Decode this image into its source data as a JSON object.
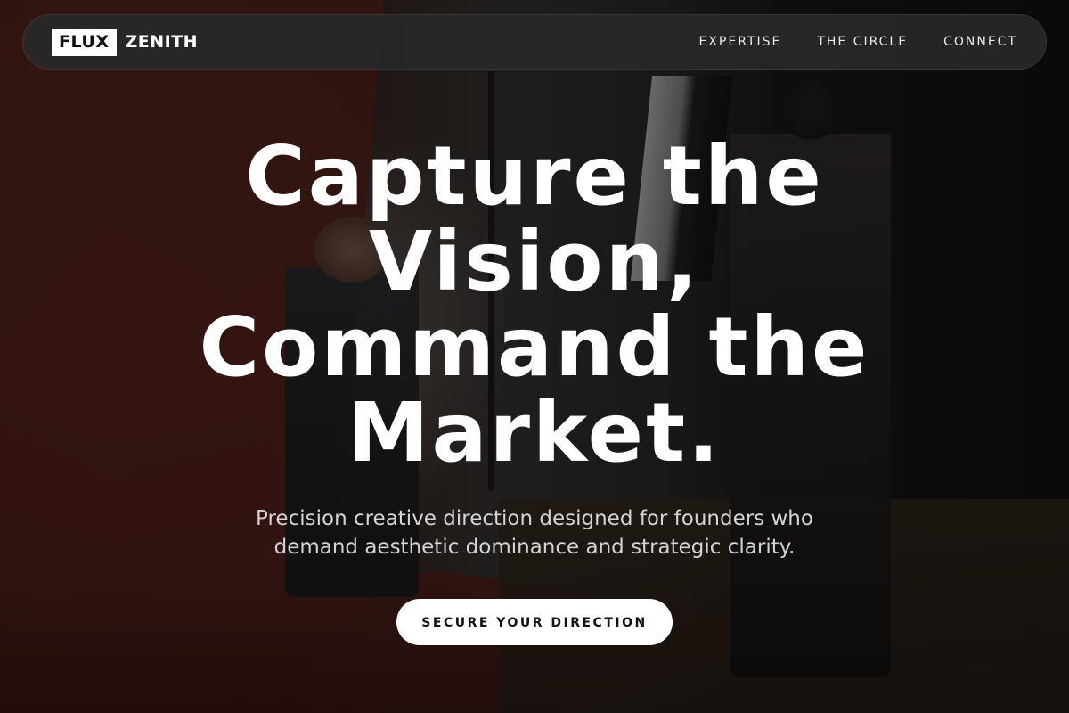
{
  "nav": {
    "brand_box": "FLUX",
    "brand_word": "ZENITH",
    "links": [
      {
        "label": "EXPERTISE"
      },
      {
        "label": "THE CIRCLE"
      },
      {
        "label": "CONNECT"
      }
    ]
  },
  "hero": {
    "headline": "Capture the Vision, Command the Market.",
    "subhead": "Precision creative direction designed for founders who demand aesthetic dominance and strategic clarity.",
    "cta_label": "SECURE YOUR DIRECTION"
  },
  "colors": {
    "accent": "#ffffff",
    "nav_bg": "#282828",
    "backdrop_red": "#5b2520"
  }
}
